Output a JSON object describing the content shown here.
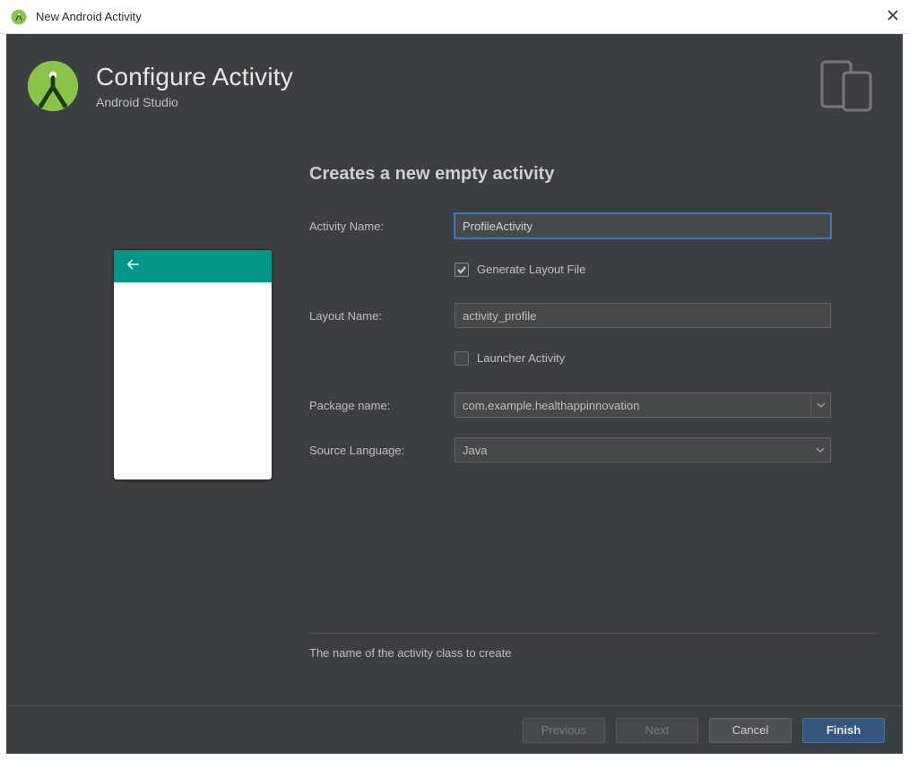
{
  "window": {
    "title": "New Android Activity"
  },
  "header": {
    "title": "Configure Activity",
    "subtitle": "Android Studio"
  },
  "section": {
    "title": "Creates a new empty activity"
  },
  "form": {
    "activity_name": {
      "label": "Activity Name:",
      "value": "ProfileActivity"
    },
    "generate_layout": {
      "label": "Generate Layout File",
      "checked": true
    },
    "layout_name": {
      "label": "Layout Name:",
      "value": "activity_profile"
    },
    "launcher": {
      "label": "Launcher Activity",
      "checked": false
    },
    "package_name": {
      "label": "Package name:",
      "value": "com.example.healthappinnovation"
    },
    "source_language": {
      "label": "Source Language:",
      "value": "Java"
    }
  },
  "hint": "The name of the activity class to create",
  "footer": {
    "previous": "Previous",
    "next": "Next",
    "cancel": "Cancel",
    "finish": "Finish"
  },
  "colors": {
    "accent": "#009688",
    "primary_button": "#365880"
  }
}
